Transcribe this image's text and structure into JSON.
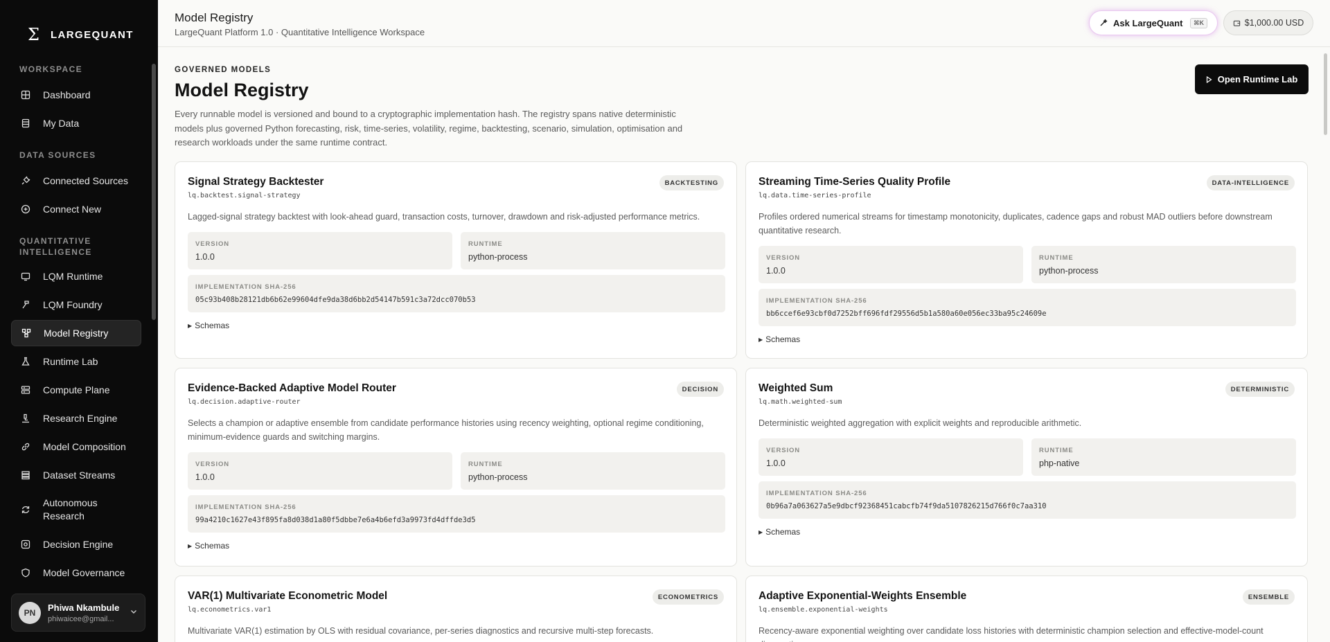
{
  "brand": {
    "name": "LARGEQUANT",
    "icon": "sigma-icon"
  },
  "sidebar": {
    "sections": [
      {
        "title": "WORKSPACE",
        "items": [
          {
            "label": "Dashboard",
            "icon": "grid-icon"
          },
          {
            "label": "My Data",
            "icon": "database-icon"
          }
        ]
      },
      {
        "title": "DATA SOURCES",
        "items": [
          {
            "label": "Connected Sources",
            "icon": "plug-icon"
          },
          {
            "label": "Connect New",
            "icon": "plus-circle-icon"
          }
        ]
      },
      {
        "title": "QUANTITATIVE INTELLIGENCE",
        "items": [
          {
            "label": "LQM Runtime",
            "icon": "monitor-icon"
          },
          {
            "label": "LQM Foundry",
            "icon": "hammer-icon"
          },
          {
            "label": "Model Registry",
            "icon": "network-icon",
            "active": true
          },
          {
            "label": "Runtime Lab",
            "icon": "flask-icon"
          },
          {
            "label": "Compute Plane",
            "icon": "server-icon"
          },
          {
            "label": "Research Engine",
            "icon": "microscope-icon"
          },
          {
            "label": "Model Composition",
            "icon": "link-icon"
          },
          {
            "label": "Dataset Streams",
            "icon": "layers-icon"
          },
          {
            "label": "Autonomous Research",
            "icon": "refresh-icon"
          },
          {
            "label": "Decision Engine",
            "icon": "target-icon"
          },
          {
            "label": "Model Governance",
            "icon": "shield-icon"
          }
        ]
      }
    ]
  },
  "user": {
    "initials": "PN",
    "name": "Phiwa Nkambule",
    "email": "phiwaicee@gmail..."
  },
  "topbar": {
    "title": "Model Registry",
    "subtitle": "LargeQuant Platform 1.0 · Quantitative Intelligence Workspace",
    "ask_label": "Ask LargeQuant",
    "ask_kbd": "⌘K",
    "balance": "$1,000.00 USD"
  },
  "header": {
    "kicker": "GOVERNED MODELS",
    "title": "Model Registry",
    "description": "Every runnable model is versioned and bound to a cryptographic implementation hash. The registry spans native deterministic models plus governed Python forecasting, risk, time-series, volatility, regime, backtesting, scenario, simulation, optimisation and research workloads under the same runtime contract.",
    "open_lab_label": "Open Runtime Lab"
  },
  "labels": {
    "version": "VERSION",
    "runtime": "RUNTIME",
    "sha": "IMPLEMENTATION SHA-256",
    "schemas": "Schemas"
  },
  "models": [
    {
      "title": "Signal Strategy Backtester",
      "id": "lq.backtest.signal-strategy",
      "tag": "BACKTESTING",
      "description": "Lagged-signal strategy backtest with look-ahead guard, transaction costs, turnover, drawdown and risk-adjusted performance metrics.",
      "version": "1.0.0",
      "runtime": "python-process",
      "sha": "05c93b408b28121db6b62e99604dfe9da38d6bb2d54147b591c3a72dcc070b53"
    },
    {
      "title": "Streaming Time-Series Quality Profile",
      "id": "lq.data.time-series-profile",
      "tag": "DATA-INTELLIGENCE",
      "description": "Profiles ordered numerical streams for timestamp monotonicity, duplicates, cadence gaps and robust MAD outliers before downstream quantitative research.",
      "version": "1.0.0",
      "runtime": "python-process",
      "sha": "bb6ccef6e93cbf0d7252bff696fdf29556d5b1a580a60e056ec33ba95c24609e"
    },
    {
      "title": "Evidence-Backed Adaptive Model Router",
      "id": "lq.decision.adaptive-router",
      "tag": "DECISION",
      "description": "Selects a champion or adaptive ensemble from candidate performance histories using recency weighting, optional regime conditioning, minimum-evidence guards and switching margins.",
      "version": "1.0.0",
      "runtime": "python-process",
      "sha": "99a4210c1627e43f895fa8d038d1a80f5dbbe7e6a4b6efd3a9973fd4dffde3d5"
    },
    {
      "title": "Weighted Sum",
      "id": "lq.math.weighted-sum",
      "tag": "DETERMINISTIC",
      "description": "Deterministic weighted aggregation with explicit weights and reproducible arithmetic.",
      "version": "1.0.0",
      "runtime": "php-native",
      "sha": "0b96a7a063627a5e9dbcf92368451cabcfb74f9da5107826215d766f0c7aa310"
    },
    {
      "title": "VAR(1) Multivariate Econometric Model",
      "id": "lq.econometrics.var1",
      "tag": "ECONOMETRICS",
      "description": "Multivariate VAR(1) estimation by OLS with residual covariance, per-series diagnostics and recursive multi-step forecasts."
    },
    {
      "title": "Adaptive Exponential-Weights Ensemble",
      "id": "lq.ensemble.exponential-weights",
      "tag": "ENSEMBLE",
      "description": "Recency-aware exponential weighting over candidate loss histories with deterministic champion selection and effective-model-count diagnostics."
    }
  ]
}
